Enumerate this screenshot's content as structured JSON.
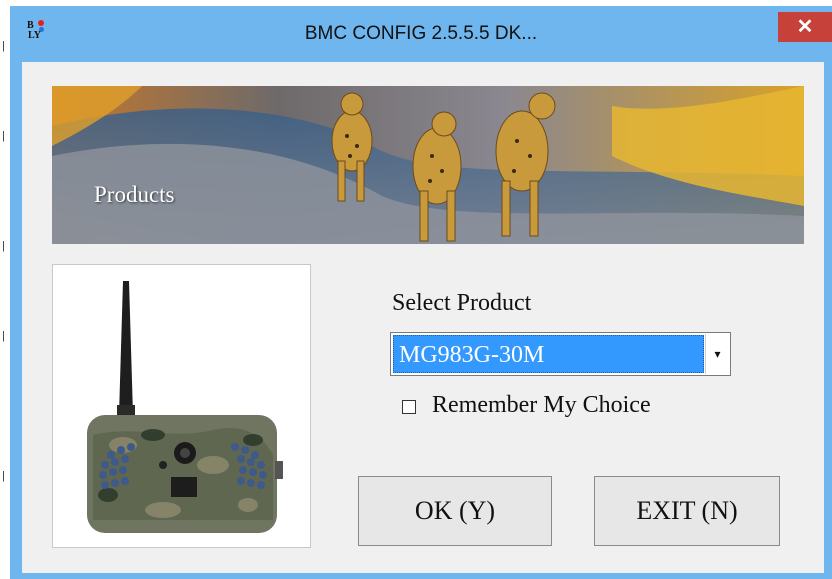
{
  "window": {
    "title": "BMC CONFIG 2.5.5.5 DK...",
    "icon_name": "bmc-ly-app-icon",
    "icon_text_top": "B",
    "icon_text_bottom": "LY",
    "close_glyph": "✕",
    "titlebar_color": "#6fb6ee",
    "close_color": "#c7413b"
  },
  "banner": {
    "label": "Products",
    "image": "cheetahs-banner"
  },
  "product_image": "trail-camera-image",
  "form": {
    "select_label": "Select Product",
    "selected_product": "MG983G-30M",
    "dropdown_arrow_glyph": "▾",
    "remember_label": "Remember My Choice",
    "remember_checked": false,
    "selection_color": "#3399ff"
  },
  "buttons": {
    "ok": "OK (Y)",
    "exit": "EXIT (N)"
  }
}
